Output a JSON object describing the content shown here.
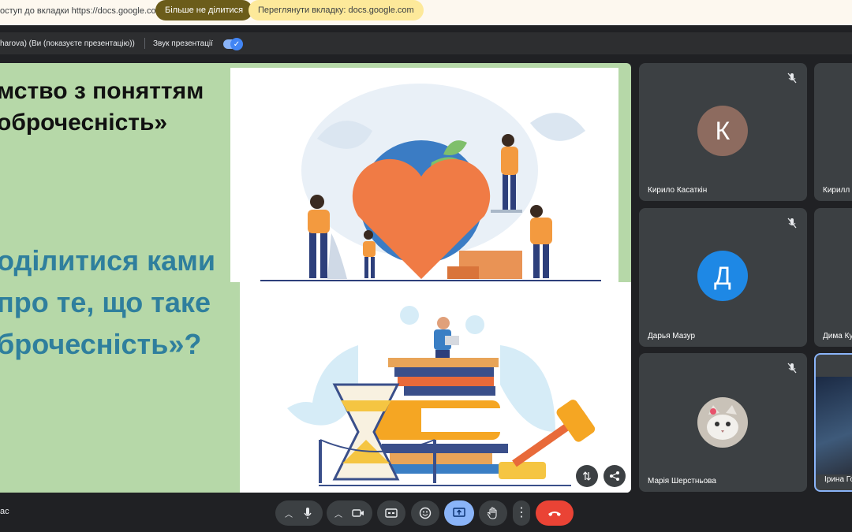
{
  "share_banner": {
    "text": "оступ до вкладки https://docs.google.com",
    "stop_label": "Більше не ділитися",
    "view_label": "Переглянути вкладку: docs.google.com"
  },
  "presentation_bar": {
    "presenter": "harova) (Ви (показуєте презентацію))",
    "sound_label": "Звук презентації",
    "sound_enabled": true
  },
  "slide": {
    "title": "мство з поняттям оброчесність»",
    "question": "оділитися ками про те, що таке брочесність»?"
  },
  "participants": [
    {
      "name": "Кирило Касаткін",
      "initial": "К",
      "avatar_color": "#8d6b5f",
      "muted": true
    },
    {
      "name": "Кирилл",
      "muted": true
    },
    {
      "name": "Дарья Мазур",
      "initial": "Д",
      "avatar_color": "#1e88e5",
      "muted": true
    },
    {
      "name": "Дима Ку",
      "muted": true
    },
    {
      "name": "Марія Шерстньова",
      "muted": true
    },
    {
      "name": "Ірина Го"
    }
  ],
  "bottom_bar": {
    "meeting_code": "ас"
  },
  "colors": {
    "leave_button": "#ea4335",
    "present_active": "#8ab4f8"
  }
}
